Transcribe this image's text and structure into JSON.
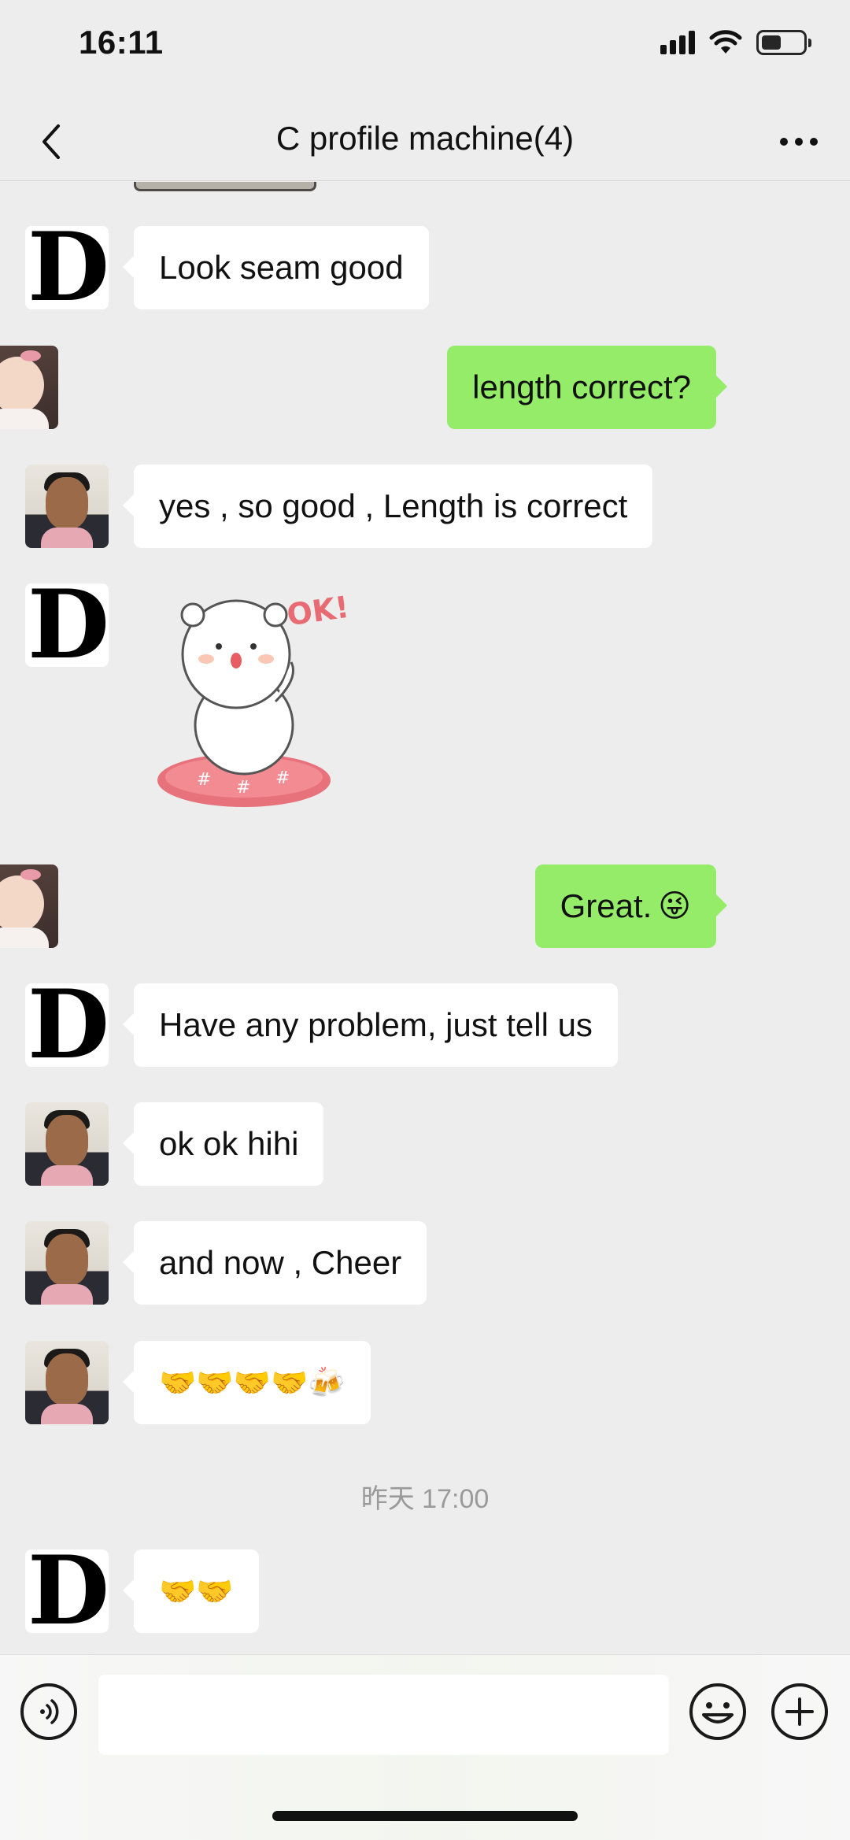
{
  "status_bar": {
    "time": "16:11"
  },
  "nav": {
    "title": "C profile machine(4)"
  },
  "messages": [
    {
      "sender": "D",
      "side": "left",
      "type": "text",
      "text": "Look seam good"
    },
    {
      "sender": "me",
      "side": "right",
      "type": "text",
      "text": "length correct?"
    },
    {
      "sender": "man",
      "side": "left",
      "type": "text",
      "text": "yes , so good , Length is correct"
    },
    {
      "sender": "D",
      "side": "left",
      "type": "sticker",
      "sticker_text": "OK!"
    },
    {
      "sender": "me",
      "side": "right",
      "type": "text",
      "text": "Great.",
      "emoji": "😜"
    },
    {
      "sender": "D",
      "side": "left",
      "type": "text",
      "text": "Have any problem, just tell us"
    },
    {
      "sender": "man",
      "side": "left",
      "type": "text",
      "text": "ok ok hihi"
    },
    {
      "sender": "man",
      "side": "left",
      "type": "text",
      "text": "and now , Cheer"
    },
    {
      "sender": "man",
      "side": "left",
      "type": "text",
      "text": "🤝🤝🤝🤝🍻"
    },
    {
      "sender": "D",
      "side": "left",
      "type": "text",
      "text": "🤝🤝"
    }
  ],
  "timestamp": "昨天 17:00",
  "avatars": {
    "d_letter": "D"
  },
  "input": {
    "placeholder": ""
  },
  "icons": [
    "back-icon",
    "more-icon",
    "voice-icon",
    "emoji-icon",
    "plus-icon",
    "signal-icon",
    "wifi-icon",
    "battery-icon"
  ]
}
